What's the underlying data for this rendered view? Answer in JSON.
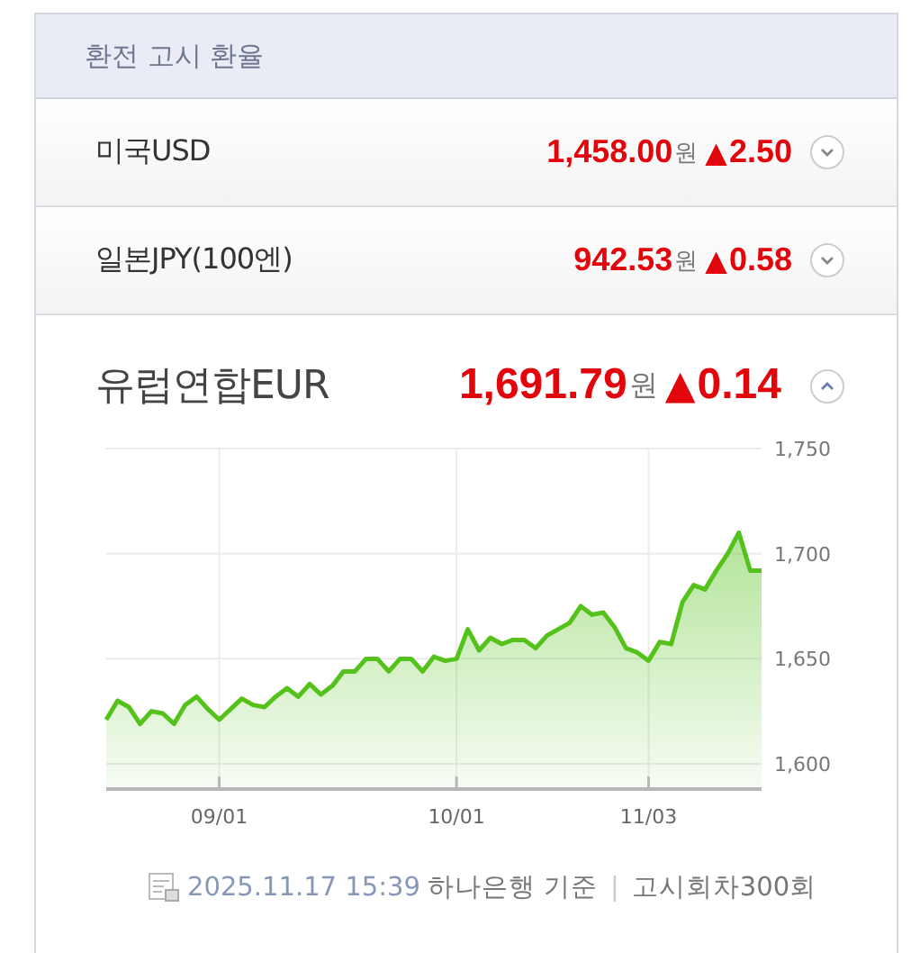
{
  "panel": {
    "title": "환전 고시 환율"
  },
  "rates": [
    {
      "name": "미국USD",
      "rate": "1,458.00",
      "unit": "원",
      "arrow": "▲",
      "change": "2.50",
      "expanded": false
    },
    {
      "name": "일본JPY(100엔)",
      "rate": "942.53",
      "unit": "원",
      "arrow": "▲",
      "change": "0.58",
      "expanded": false
    },
    {
      "name": "유럽연합EUR",
      "rate": "1,691.79",
      "unit": "원",
      "arrow": "▲",
      "change": "0.14",
      "expanded": true,
      "chart_data": {
        "type": "area",
        "categories": [
          null,
          null,
          null,
          null,
          null,
          null,
          null,
          null,
          null,
          null,
          "09/01",
          null,
          null,
          null,
          null,
          null,
          null,
          null,
          null,
          null,
          null,
          null,
          null,
          null,
          null,
          null,
          null,
          null,
          null,
          null,
          null,
          "10/01",
          null,
          null,
          null,
          null,
          null,
          null,
          null,
          null,
          null,
          null,
          null,
          null,
          null,
          null,
          null,
          null,
          "11/03",
          null,
          null,
          null,
          null,
          null,
          null,
          null,
          null,
          null,
          null
        ],
        "series": [
          {
            "color": "#55c21b",
            "values": [
              1621,
              1630,
              1627,
              1619,
              1625,
              1624,
              1619,
              1628,
              1632,
              1626,
              1621,
              1626,
              1631,
              1628,
              1627,
              1632,
              1636,
              1632,
              1638,
              1633,
              1637,
              1644,
              1644,
              1650,
              1650,
              1644,
              1650,
              1650,
              1644,
              1651,
              1649,
              1650,
              1664,
              1654,
              1660,
              1657,
              1659,
              1659,
              1655,
              1661,
              1664,
              1667,
              1675,
              1671,
              1672,
              1665,
              1655,
              1653,
              1649,
              1658,
              1657,
              1677,
              1685,
              1683,
              1692,
              1700,
              1710,
              1692,
              1692
            ]
          }
        ],
        "ylim": [
          1588,
          1750
        ],
        "grid": true,
        "yticks": [
          {
            "value": 1600,
            "label": "1,600"
          },
          {
            "value": 1650,
            "label": "1,650"
          },
          {
            "value": 1700,
            "label": "1,700"
          },
          {
            "value": 1750,
            "label": "1,750"
          }
        ]
      }
    }
  ],
  "footer": {
    "datetime": "2025.11.17 15:39",
    "basis": "하나은행 기준",
    "separator": "|",
    "round": "고시회차300회"
  }
}
